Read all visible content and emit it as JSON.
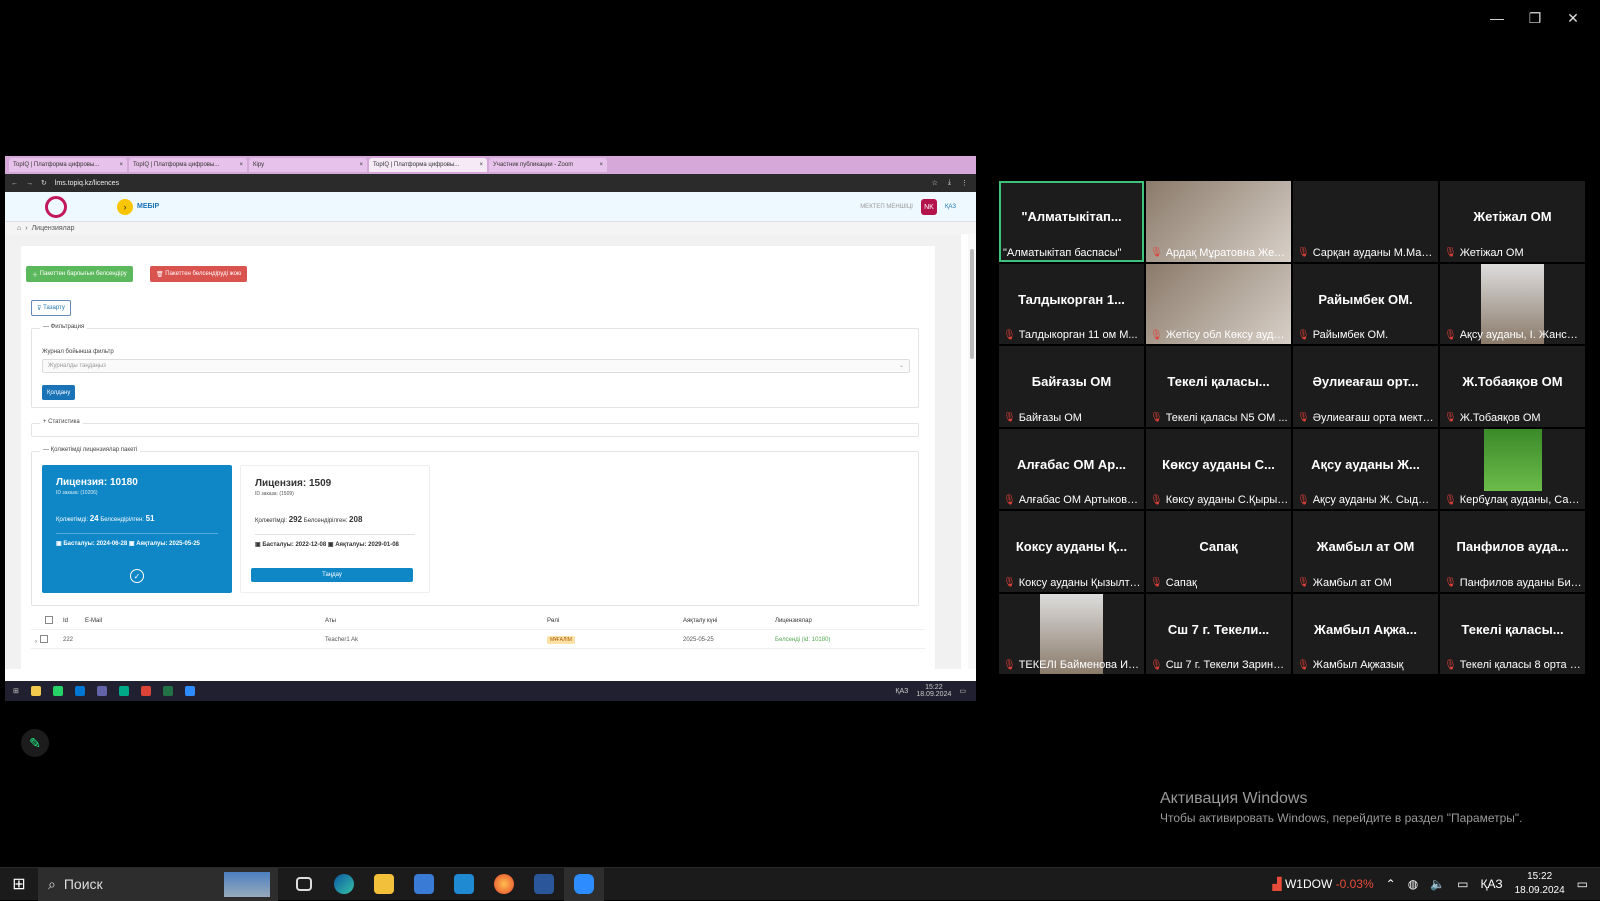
{
  "browser": {
    "tabs": [
      "TopIQ | Платформа цифровы...",
      "TopIQ | Платформа цифровы...",
      "Кіру",
      "TopIQ | Платформа цифровы...",
      "Участник публикации - Zoom"
    ],
    "url": "lms.topiq.kz/licences"
  },
  "lms": {
    "nav_label": "МЕКТЕП МЕНШІЦІ",
    "mebir": "МЕБІР",
    "lang": "ҚАЗ",
    "avatar": "NK",
    "breadcrumb": "Лицензиялар",
    "btn_activate_all": "Пакеттен барлығын белсендіру",
    "btn_deactivate": "Пакеттен белсендіруді жою",
    "btn_clear": "Тазарту",
    "filter_legend": "Фильтрация",
    "filter_label": "Журнал бойынша фильтр",
    "filter_placeholder": "Журналды таңдаңыз",
    "btn_apply": "Қолдану",
    "stats_legend": "Статистика",
    "packets_legend": "Қолжетімді лицензиялар пакеті",
    "licenses": [
      {
        "title": "Лицензия: 10180",
        "order": "ID заказа: (10206)",
        "avail_label": "Қолжетімді:",
        "avail": "24",
        "active_label": "Белсендірілген:",
        "active": "51",
        "start_label": "Басталуы:",
        "start": "2024-06-28",
        "end_label": "Аяқталуы:",
        "end": "2025-05-25"
      },
      {
        "title": "Лицензия: 1509",
        "order": "ID заказа: (1509)",
        "avail_label": "Қолжетімді:",
        "avail": "292",
        "active_label": "Белсендірілген:",
        "active": "208",
        "start_label": "Басталуы:",
        "start": "2022-12-08",
        "end_label": "Аяқталуы:",
        "end": "2029-01-08",
        "choose": "Таңдау"
      }
    ],
    "table": {
      "headers": [
        "Id",
        "E-Mail",
        "Аты",
        "Рөлі",
        "Аяқталу күні",
        "Лицензиялар"
      ],
      "rows": [
        [
          "222",
          "",
          "Teacher1 Ak",
          "МҰҒАЛІМ",
          "2025-05-25",
          "Белсенді (id: 10180)"
        ]
      ]
    },
    "mini_taskbar": {
      "lang": "ҚАЗ",
      "time": "15:22",
      "date": "18.09.2024"
    }
  },
  "gallery": [
    {
      "big": "\"Алматыкітап...",
      "name": "\"Алматыкітап баспасы\"",
      "mic": false,
      "speaking": true
    },
    {
      "big": "",
      "name": "Ардақ Мұратовна Жеті...",
      "mic": true,
      "video": true
    },
    {
      "big": "",
      "name": "Сарқан ауданы М.Мам...",
      "mic": true
    },
    {
      "big": "Жетіжал ОМ",
      "name": "Жетіжал ОМ",
      "mic": true
    },
    {
      "big": "Талдыкорган 1...",
      "name": "Талдыкорган 11 ом  М...",
      "mic": true
    },
    {
      "big": "",
      "name": "Жетісу обл Көксу аудан...",
      "mic": true,
      "video": true
    },
    {
      "big": "Райымбек ОМ.",
      "name": "Райымбек ОМ.",
      "mic": true
    },
    {
      "big": "",
      "name": "Ақсу ауданы, І. Жансүгі...",
      "mic": true,
      "video": true
    },
    {
      "big": "Байғазы ОМ",
      "name": "Байғазы ОМ",
      "mic": true
    },
    {
      "big": "Текелі қаласы...",
      "name": "Текелі қаласы N5 ОМ ...",
      "mic": true
    },
    {
      "big": "Әулиеағаш орт...",
      "name": "Әулиеағаш орта мектебі",
      "mic": true
    },
    {
      "big": "Ж.Тобаяқов ОМ",
      "name": "Ж.Тобаяқов ОМ",
      "mic": true
    },
    {
      "big": "Алғабас ОМ Ар...",
      "name": "Алғабас ОМ Артыкова ...",
      "mic": true
    },
    {
      "big": "Көксу ауданы С...",
      "name": "Көксу ауданы С.Қырық...",
      "mic": true
    },
    {
      "big": "Ақсу ауданы Ж...",
      "name": "Ақсу ауданы Ж. Сыдык...",
      "mic": true
    },
    {
      "big": "",
      "name": "Кербұлақ ауданы, Сар...",
      "mic": true,
      "video": true
    },
    {
      "big": "Коксу  ауданы Қ...",
      "name": "Коксу ауданы Қызылтоғ...",
      "mic": true
    },
    {
      "big": "Сапақ",
      "name": "Сапақ",
      "mic": true
    },
    {
      "big": "Жамбыл ат ОМ",
      "name": "Жамбыл ат ОМ",
      "mic": true
    },
    {
      "big": "Панфилов ауда...",
      "name": "Панфилов ауданы Била...",
      "mic": true
    },
    {
      "big": "",
      "name": "ТЕКЕЛІ Байменова Ил...",
      "mic": true,
      "video": true
    },
    {
      "big": "Сш 7 г. Текели...",
      "name": "Сш 7 г. Текели Зарина ...",
      "mic": true
    },
    {
      "big": "Жамбыл Ақжа...",
      "name": "Жамбыл Ақжазық",
      "mic": true
    },
    {
      "big": "Текелі қаласы...",
      "name": "Текелі қаласы 8 орта м...",
      "mic": true
    }
  ],
  "activation": {
    "line1": "Активация Windows",
    "line2": "Чтобы активировать Windows, перейдите в раздел \"Параметры\"."
  },
  "taskbar": {
    "search": "Поиск",
    "stock_name": "W1DOW",
    "stock_change": "-0.03%",
    "lang": "ҚАЗ",
    "time": "15:22",
    "date": "18.09.2024"
  }
}
